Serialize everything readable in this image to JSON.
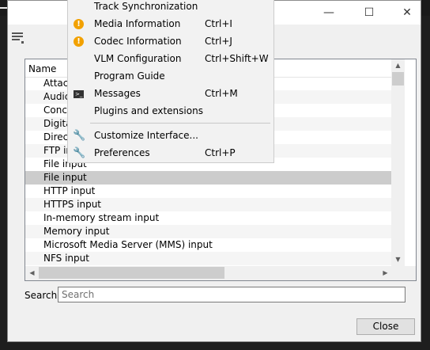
{
  "titlebar": {
    "minimize_icon": "minimize-icon",
    "maximize_icon": "maximize-icon",
    "close_icon": "close-icon"
  },
  "list": {
    "header": "Name",
    "rows": [
      "Attac",
      "Audic",
      "Conca",
      "Digita",
      "Direct",
      "FTP in",
      "File input",
      "File input",
      "HTTP input",
      "HTTPS input",
      "In-memory stream input",
      "Memory input",
      "Microsoft Media Server (MMS) input",
      "NFS input"
    ],
    "selected_index": 7
  },
  "search": {
    "label": "Search:",
    "placeholder": "Search",
    "value": ""
  },
  "close_button": "Close",
  "menu": {
    "items": [
      {
        "label": "Track Synchronization",
        "shortcut": "",
        "icon": ""
      },
      {
        "label": "Media Information",
        "shortcut": "Ctrl+I",
        "icon": "info-icon"
      },
      {
        "label": "Codec Information",
        "shortcut": "Ctrl+J",
        "icon": "info-icon"
      },
      {
        "label": "VLM Configuration",
        "shortcut": "Ctrl+Shift+W",
        "icon": ""
      },
      {
        "label": "Program Guide",
        "shortcut": "",
        "icon": ""
      },
      {
        "label": "Messages",
        "shortcut": "Ctrl+M",
        "icon": "terminal-icon"
      },
      {
        "label": "Plugins and extensions",
        "shortcut": "",
        "icon": ""
      },
      {
        "label": "Customize Interface...",
        "shortcut": "",
        "icon": "wrench-icon"
      },
      {
        "label": "Preferences",
        "shortcut": "Ctrl+P",
        "icon": "wrench-icon"
      }
    ]
  },
  "colors": {
    "menu_bg": "#f2f2f2",
    "info_accent": "#f2a100",
    "selection": "#cccccc"
  }
}
